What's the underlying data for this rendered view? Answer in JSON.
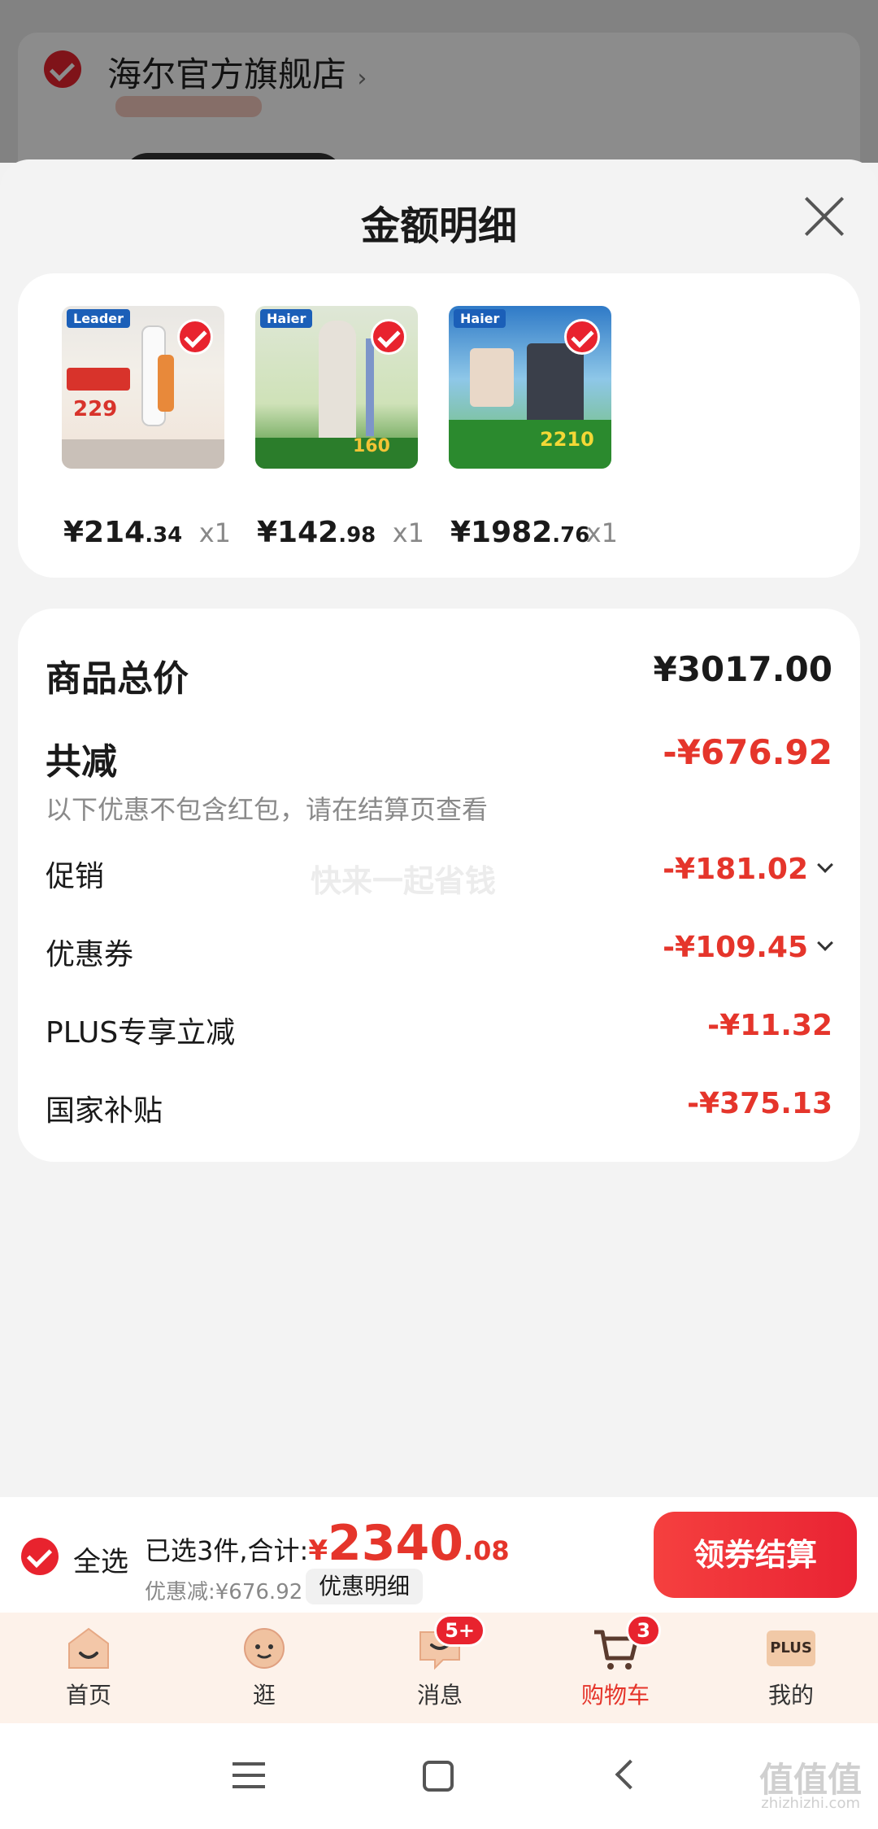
{
  "background": {
    "store_name": "海尔官方旗舰店",
    "store_arrow": "›"
  },
  "sheet": {
    "title": "金额明细"
  },
  "products": [
    {
      "brand": "Leader",
      "price_int": "¥214",
      "price_dec": ".34",
      "qty": "x1",
      "promo": "229"
    },
    {
      "brand": "Haier",
      "price_int": "¥142",
      "price_dec": ".98",
      "qty": "x1",
      "promo": "160"
    },
    {
      "brand": "Haier",
      "price_int": "¥1982",
      "price_dec": ".76",
      "qty": "x1",
      "promo": "2210"
    }
  ],
  "summary": {
    "total_label": "商品总价",
    "total_value": "¥3017.00",
    "reduce_label": "共减",
    "reduce_value": "-¥676.92",
    "note": "以下优惠不包含红包，请在结算页查看",
    "watermark": "快来一起省钱",
    "items": [
      {
        "label": "促销",
        "value": "-¥181.02",
        "expandable": true
      },
      {
        "label": "优惠券",
        "value": "-¥109.45",
        "expandable": true
      },
      {
        "label": "PLUS专享立减",
        "value": "-¥11.32",
        "expandable": false
      },
      {
        "label": "国家补贴",
        "value": "-¥375.13",
        "expandable": false
      }
    ]
  },
  "action_bar": {
    "select_all": "全选",
    "selected_prefix": "已选3件,合计:",
    "yen": "¥",
    "total_int": "2340",
    "total_dec": ".08",
    "discount": "优惠减:¥676.92",
    "detail_button": "优惠明细",
    "checkout_button": "领券结算"
  },
  "tabs": [
    {
      "label": "首页",
      "icon": "home-icon",
      "active": false
    },
    {
      "label": "逛",
      "icon": "browse-icon",
      "active": false
    },
    {
      "label": "消息",
      "icon": "message-icon",
      "badge": "5+",
      "active": false
    },
    {
      "label": "购物车",
      "icon": "cart-icon",
      "badge": "3",
      "active": true
    },
    {
      "label": "我的",
      "icon": "profile-icon",
      "badge_text": "PLUS",
      "active": false
    }
  ],
  "colors": {
    "accent": "#e5352b",
    "checkbox": "#e8232e",
    "tabbar_bg": "#fdf2ea"
  },
  "system_watermark": "值值值",
  "system_watermark_url": "zhizhizhi.com"
}
